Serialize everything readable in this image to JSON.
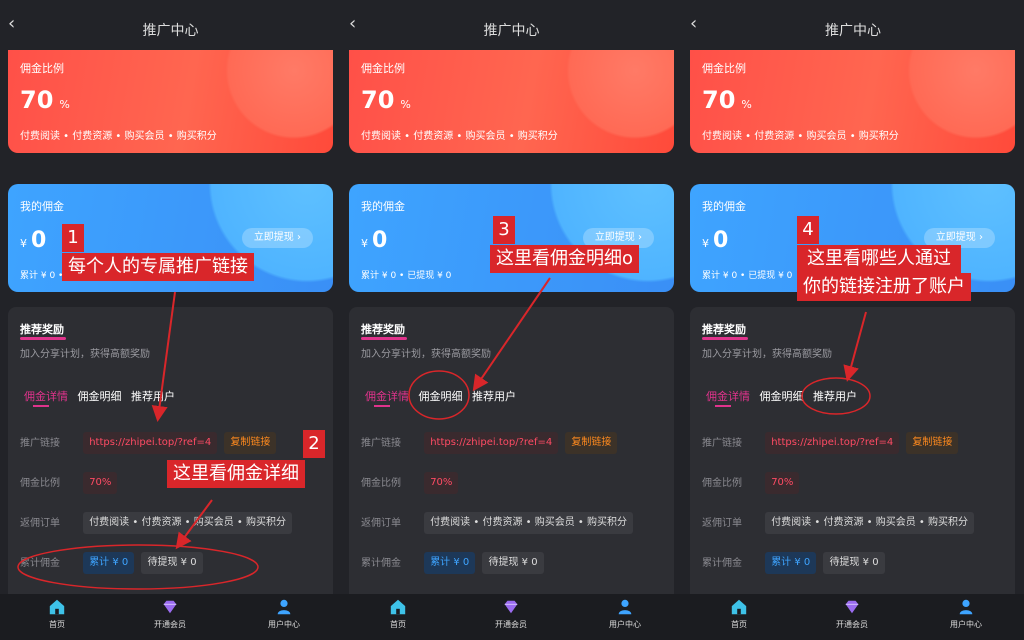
{
  "header": {
    "title": "推广中心",
    "back_icon": "chevron-left-icon"
  },
  "commission_card": {
    "label": "佣金比例",
    "value": "70",
    "unit": "%",
    "tags": "付费阅读 • 付费资源 • 购买会员 • 购买积分"
  },
  "my_commission": {
    "label": "我的佣金",
    "currency": "¥",
    "value": "0",
    "withdraw_label": "立即提现 ›",
    "summary": "累计 ¥ 0 • 已提现 ¥ 0"
  },
  "reward": {
    "title": "推荐奖励",
    "subtitle": "加入分享计划，获得高额奖励",
    "tabs": [
      "佣金详情",
      "佣金明细",
      "推荐用户"
    ],
    "rows": {
      "link_label": "推广链接",
      "link_value": "https://zhipei.top/?ref=4",
      "copy_label": "复制链接",
      "rate_label": "佣金比例",
      "rate_value": "70%",
      "orders_label": "返佣订单",
      "orders_values": [
        "付费阅读 •",
        "付费资源 •",
        "购买会员 •",
        "购买积分"
      ],
      "total_label": "累计佣金",
      "total_value": "累计 ¥ 0",
      "pending_value": "待提现 ¥ 0"
    }
  },
  "tabbar": {
    "items": [
      {
        "label": "首页",
        "icon": "home-icon"
      },
      {
        "label": "开通会员",
        "icon": "diamond-icon"
      },
      {
        "label": "用户中心",
        "icon": "user-icon"
      }
    ]
  },
  "annotations": {
    "a1": {
      "num": "1",
      "text": "每个人的专属推广链接"
    },
    "a2": {
      "num": "2",
      "text": "这里看佣金详细"
    },
    "a3": {
      "num": "3",
      "text": "这里看佣金明细o"
    },
    "a4": {
      "num": "4",
      "line1": "这里看哪些人通过",
      "line2": "你的链接注册了账户"
    }
  },
  "colors": {
    "accent": "#e0338c",
    "annot": "#d9262a",
    "blue": "#3ea4ff",
    "red": "#ff5048"
  }
}
